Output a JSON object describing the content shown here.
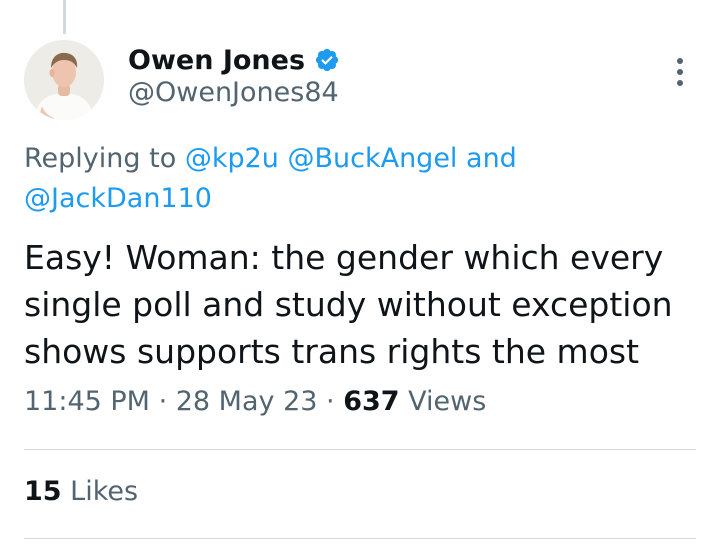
{
  "tweet": {
    "author": {
      "display_name": "Owen Jones",
      "handle": "@OwenJones84",
      "verified": true,
      "avatar_icon": "profile-photo"
    },
    "replying_to": {
      "prefix": "Replying to ",
      "mentions": [
        "@kp2u",
        "@BuckAngel",
        "@JackDan110"
      ],
      "conjunction": " and",
      "separator": " "
    },
    "text_lines": [
      "Easy! Woman: the gender which every",
      "single poll and study without exception",
      "shows supports trans rights the most"
    ],
    "meta": {
      "time": "11:45 PM",
      "separator": " · ",
      "date": "28 May 23",
      "views_count": "637",
      "views_label": " Views"
    },
    "likes": {
      "count": "15",
      "label": " Likes"
    }
  },
  "colors": {
    "link": "#1d9bf0",
    "secondary_text": "#536471",
    "primary_text": "#0f1419",
    "divider": "#cfd9de",
    "verified_badge": "#1d9bf0"
  },
  "icons": {
    "more": "more-options-icon",
    "verified": "verified-badge-icon"
  }
}
